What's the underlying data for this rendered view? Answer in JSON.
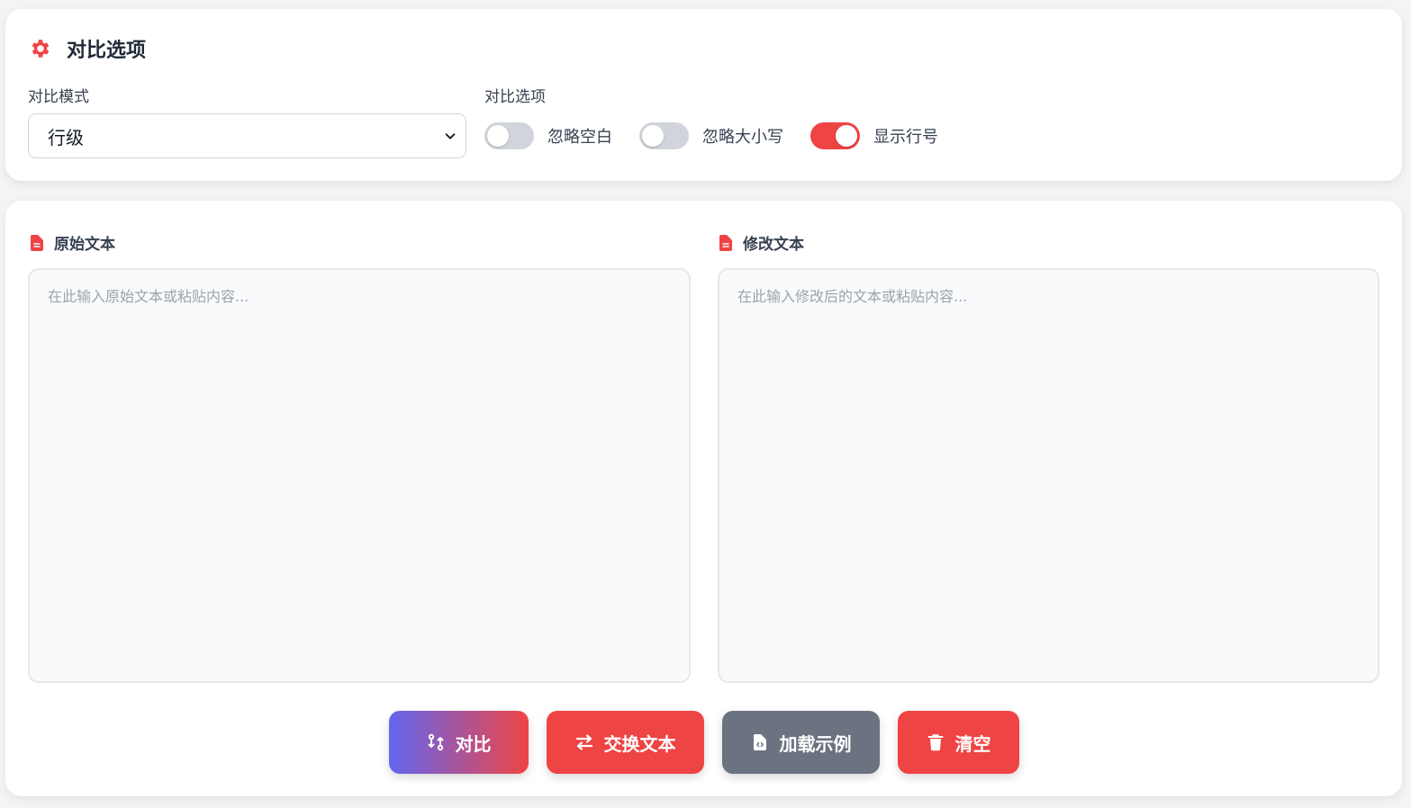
{
  "options": {
    "title": "对比选项",
    "mode_label": "对比模式",
    "mode_value": "行级",
    "options_label": "对比选项",
    "toggles": [
      {
        "label": "忽略空白",
        "on": false
      },
      {
        "label": "忽略大小写",
        "on": false
      },
      {
        "label": "显示行号",
        "on": true
      }
    ]
  },
  "editor": {
    "original_label": "原始文本",
    "original_placeholder": "在此输入原始文本或粘贴内容...",
    "modified_label": "修改文本",
    "modified_placeholder": "在此输入修改后的文本或粘贴内容..."
  },
  "actions": {
    "compare_label": "对比",
    "swap_label": "交换文本",
    "example_label": "加载示例",
    "clear_label": "清空"
  },
  "colors": {
    "accent": "#ef4444",
    "neutral_button": "#6b7280",
    "gradient_start": "#6366f1"
  }
}
